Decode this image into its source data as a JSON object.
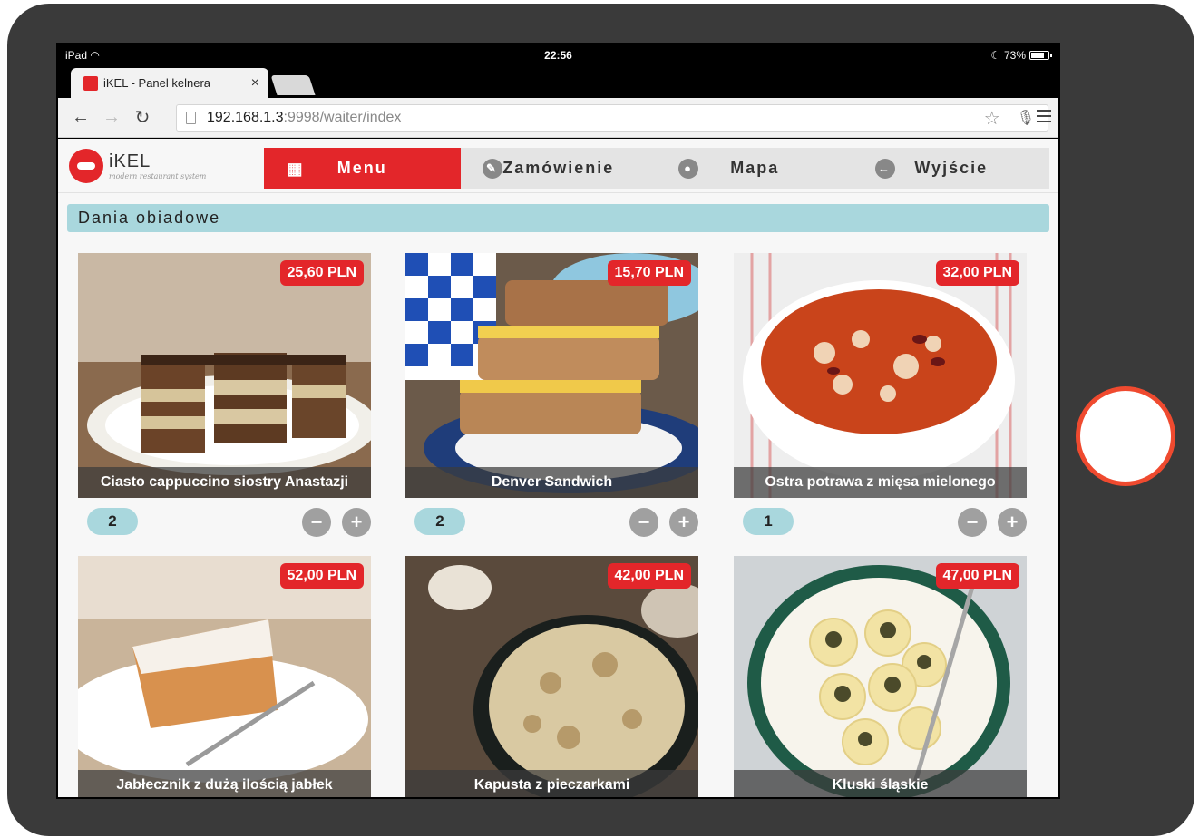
{
  "status_bar": {
    "device": "iPad",
    "time": "22:56",
    "battery": "73%"
  },
  "browser": {
    "tab_title": "iKEL - Panel kelnera",
    "tab_close": "×",
    "url_host": "192.168.1.3",
    "url_path": ":9998/waiter/index"
  },
  "app": {
    "logo_title": "iKEL",
    "logo_subtitle": "modern restaurant system",
    "nav": [
      {
        "label": "Menu",
        "icon": "grid-icon",
        "active": true
      },
      {
        "label": "Zamówienie",
        "icon": "pencil-icon",
        "active": false
      },
      {
        "label": "Mapa",
        "icon": "map-pin-icon",
        "active": false
      },
      {
        "label": "Wyjście",
        "icon": "arrow-left-icon",
        "active": false
      }
    ],
    "section_title": "Dania obiadowe",
    "dishes": [
      {
        "name": "Ciasto cappuccino siostry Anastazji",
        "price": "25,60 PLN",
        "qty": "2",
        "photo": "layered-cake"
      },
      {
        "name": "Denver Sandwich",
        "price": "15,70 PLN",
        "qty": "2",
        "photo": "toast-sandwich"
      },
      {
        "name": "Ostra potrawa z mięsa mielonego",
        "price": "32,00 PLN",
        "qty": "1",
        "photo": "chili-bowl"
      },
      {
        "name": "Jabłecznik z dużą ilością jabłek",
        "price": "52,00 PLN",
        "photo": "apple-pie-slice"
      },
      {
        "name": "Kapusta z pieczarkami",
        "price": "42,00 PLN",
        "photo": "cabbage-mushrooms"
      },
      {
        "name": "Kluski śląskie",
        "price": "47,00 PLN",
        "photo": "silesian-dumplings"
      }
    ],
    "minus_label": "−",
    "plus_label": "+"
  },
  "colors": {
    "accent": "#e3262a",
    "section": "#a9d7dd",
    "tablet_frame": "#3a3a3a",
    "home_ring": "#ef4a2f"
  }
}
